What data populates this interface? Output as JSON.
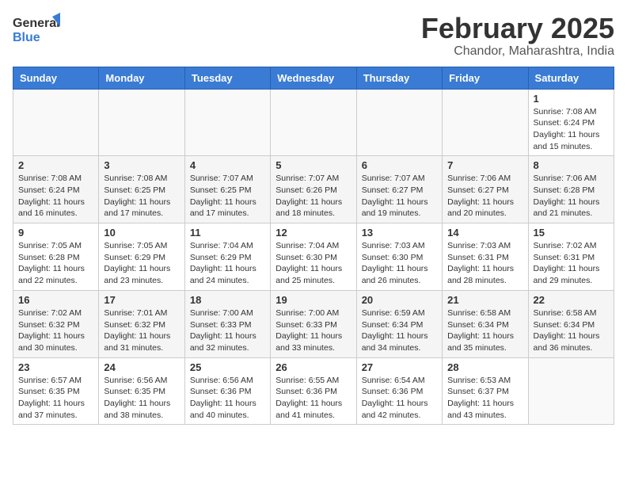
{
  "header": {
    "logo_general": "General",
    "logo_blue": "Blue",
    "month_title": "February 2025",
    "location": "Chandor, Maharashtra, India"
  },
  "weekdays": [
    "Sunday",
    "Monday",
    "Tuesday",
    "Wednesday",
    "Thursday",
    "Friday",
    "Saturday"
  ],
  "weeks": [
    [
      {
        "day": "",
        "info": ""
      },
      {
        "day": "",
        "info": ""
      },
      {
        "day": "",
        "info": ""
      },
      {
        "day": "",
        "info": ""
      },
      {
        "day": "",
        "info": ""
      },
      {
        "day": "",
        "info": ""
      },
      {
        "day": "1",
        "info": "Sunrise: 7:08 AM\nSunset: 6:24 PM\nDaylight: 11 hours\nand 15 minutes."
      }
    ],
    [
      {
        "day": "2",
        "info": "Sunrise: 7:08 AM\nSunset: 6:24 PM\nDaylight: 11 hours\nand 16 minutes."
      },
      {
        "day": "3",
        "info": "Sunrise: 7:08 AM\nSunset: 6:25 PM\nDaylight: 11 hours\nand 17 minutes."
      },
      {
        "day": "4",
        "info": "Sunrise: 7:07 AM\nSunset: 6:25 PM\nDaylight: 11 hours\nand 17 minutes."
      },
      {
        "day": "5",
        "info": "Sunrise: 7:07 AM\nSunset: 6:26 PM\nDaylight: 11 hours\nand 18 minutes."
      },
      {
        "day": "6",
        "info": "Sunrise: 7:07 AM\nSunset: 6:27 PM\nDaylight: 11 hours\nand 19 minutes."
      },
      {
        "day": "7",
        "info": "Sunrise: 7:06 AM\nSunset: 6:27 PM\nDaylight: 11 hours\nand 20 minutes."
      },
      {
        "day": "8",
        "info": "Sunrise: 7:06 AM\nSunset: 6:28 PM\nDaylight: 11 hours\nand 21 minutes."
      }
    ],
    [
      {
        "day": "9",
        "info": "Sunrise: 7:05 AM\nSunset: 6:28 PM\nDaylight: 11 hours\nand 22 minutes."
      },
      {
        "day": "10",
        "info": "Sunrise: 7:05 AM\nSunset: 6:29 PM\nDaylight: 11 hours\nand 23 minutes."
      },
      {
        "day": "11",
        "info": "Sunrise: 7:04 AM\nSunset: 6:29 PM\nDaylight: 11 hours\nand 24 minutes."
      },
      {
        "day": "12",
        "info": "Sunrise: 7:04 AM\nSunset: 6:30 PM\nDaylight: 11 hours\nand 25 minutes."
      },
      {
        "day": "13",
        "info": "Sunrise: 7:03 AM\nSunset: 6:30 PM\nDaylight: 11 hours\nand 26 minutes."
      },
      {
        "day": "14",
        "info": "Sunrise: 7:03 AM\nSunset: 6:31 PM\nDaylight: 11 hours\nand 28 minutes."
      },
      {
        "day": "15",
        "info": "Sunrise: 7:02 AM\nSunset: 6:31 PM\nDaylight: 11 hours\nand 29 minutes."
      }
    ],
    [
      {
        "day": "16",
        "info": "Sunrise: 7:02 AM\nSunset: 6:32 PM\nDaylight: 11 hours\nand 30 minutes."
      },
      {
        "day": "17",
        "info": "Sunrise: 7:01 AM\nSunset: 6:32 PM\nDaylight: 11 hours\nand 31 minutes."
      },
      {
        "day": "18",
        "info": "Sunrise: 7:00 AM\nSunset: 6:33 PM\nDaylight: 11 hours\nand 32 minutes."
      },
      {
        "day": "19",
        "info": "Sunrise: 7:00 AM\nSunset: 6:33 PM\nDaylight: 11 hours\nand 33 minutes."
      },
      {
        "day": "20",
        "info": "Sunrise: 6:59 AM\nSunset: 6:34 PM\nDaylight: 11 hours\nand 34 minutes."
      },
      {
        "day": "21",
        "info": "Sunrise: 6:58 AM\nSunset: 6:34 PM\nDaylight: 11 hours\nand 35 minutes."
      },
      {
        "day": "22",
        "info": "Sunrise: 6:58 AM\nSunset: 6:34 PM\nDaylight: 11 hours\nand 36 minutes."
      }
    ],
    [
      {
        "day": "23",
        "info": "Sunrise: 6:57 AM\nSunset: 6:35 PM\nDaylight: 11 hours\nand 37 minutes."
      },
      {
        "day": "24",
        "info": "Sunrise: 6:56 AM\nSunset: 6:35 PM\nDaylight: 11 hours\nand 38 minutes."
      },
      {
        "day": "25",
        "info": "Sunrise: 6:56 AM\nSunset: 6:36 PM\nDaylight: 11 hours\nand 40 minutes."
      },
      {
        "day": "26",
        "info": "Sunrise: 6:55 AM\nSunset: 6:36 PM\nDaylight: 11 hours\nand 41 minutes."
      },
      {
        "day": "27",
        "info": "Sunrise: 6:54 AM\nSunset: 6:36 PM\nDaylight: 11 hours\nand 42 minutes."
      },
      {
        "day": "28",
        "info": "Sunrise: 6:53 AM\nSunset: 6:37 PM\nDaylight: 11 hours\nand 43 minutes."
      },
      {
        "day": "",
        "info": ""
      }
    ]
  ]
}
